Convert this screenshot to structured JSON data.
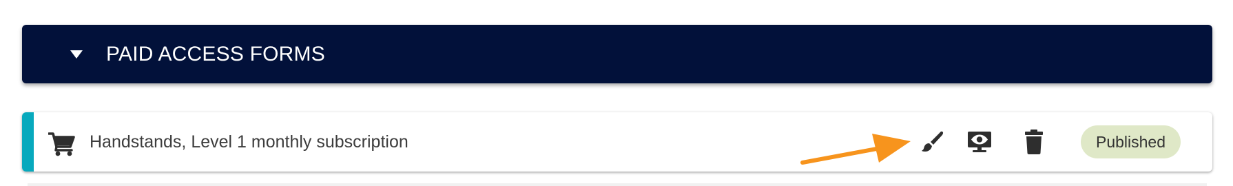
{
  "section": {
    "title": "PAID ACCESS FORMS",
    "header_color": "#02113a"
  },
  "form_row": {
    "name": "Handstands, Level 1 monthly subscription",
    "status": "Published",
    "accent_color": "#07a9bd",
    "status_color": "#dfe8c7",
    "icons": {
      "type": "cart-icon",
      "design": "brush-icon",
      "preview": "monitor-eye-icon",
      "delete": "trash-icon"
    }
  },
  "annotation": {
    "type": "arrow",
    "color": "#f7941d",
    "points_to": "brush-icon"
  }
}
